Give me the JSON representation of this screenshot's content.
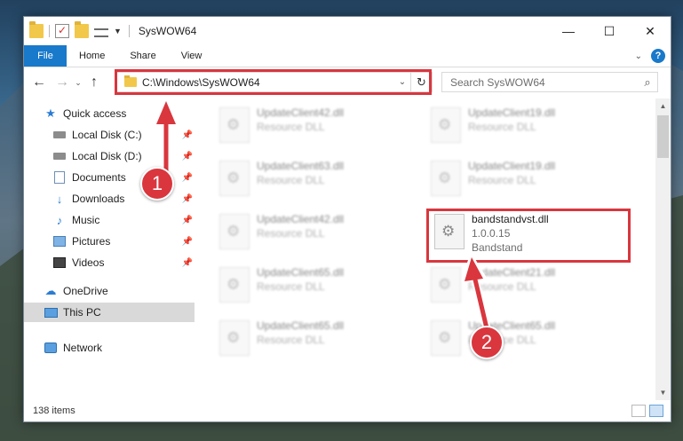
{
  "window": {
    "title": "SysWOW64",
    "controls": {
      "minimize": "—",
      "maximize": "☐",
      "close": "✕"
    }
  },
  "ribbon": {
    "tabs": [
      "File",
      "Home",
      "Share",
      "View"
    ],
    "help": "?"
  },
  "nav": {
    "back": "←",
    "forward": "→",
    "recent": "⌄",
    "up": "↑",
    "address": "C:\\Windows\\SysWOW64",
    "refresh": "↻",
    "search_placeholder": "Search SysWOW64"
  },
  "sidebar": {
    "items": [
      {
        "label": "Quick access",
        "icon": "star-icon"
      },
      {
        "label": "Local Disk (C:)",
        "icon": "disk-icon",
        "pinned": true
      },
      {
        "label": "Local Disk (D:)",
        "icon": "disk-icon",
        "pinned": true
      },
      {
        "label": "Documents",
        "icon": "documents-icon",
        "pinned": true
      },
      {
        "label": "Downloads",
        "icon": "downloads-icon",
        "pinned": true
      },
      {
        "label": "Music",
        "icon": "music-icon",
        "pinned": true
      },
      {
        "label": "Pictures",
        "icon": "pictures-icon",
        "pinned": true
      },
      {
        "label": "Videos",
        "icon": "videos-icon",
        "pinned": true
      },
      {
        "label": "OneDrive",
        "icon": "cloud-icon"
      },
      {
        "label": "This PC",
        "icon": "computer-icon",
        "selected": true
      },
      {
        "label": "Network",
        "icon": "network-icon"
      }
    ]
  },
  "files": [
    {
      "name": "UpdateClient42.dll",
      "sub": "Resource DLL",
      "blurred": true
    },
    {
      "name": "UpdateClient19.dll",
      "sub": "Resource DLL",
      "blurred": true
    },
    {
      "name": "UpdateClient63.dll",
      "sub": "Resource DLL",
      "blurred": true
    },
    {
      "name": "UpdateClient19.dll",
      "sub": "Resource DLL",
      "blurred": true
    },
    {
      "name": "UpdateClient42.dll",
      "sub": "Resource DLL",
      "blurred": true
    },
    {
      "name": "bandstandvst.dll",
      "version": "1.0.0.15",
      "sub": "Bandstand",
      "blurred": false
    },
    {
      "name": "UpdateClient65.dll",
      "sub": "Resource DLL",
      "blurred": true
    },
    {
      "name": "UpdateClient21.dll",
      "sub": "Resource DLL",
      "blurred": true
    },
    {
      "name": "UpdateClient65.dll",
      "sub": "Resource DLL",
      "blurred": true
    },
    {
      "name": "UpdateClient65.dll",
      "sub": "Resource DLL",
      "blurred": true
    }
  ],
  "status": {
    "count": "138 items"
  },
  "annotations": {
    "step1": "1",
    "step2": "2",
    "color": "#d9363e"
  }
}
